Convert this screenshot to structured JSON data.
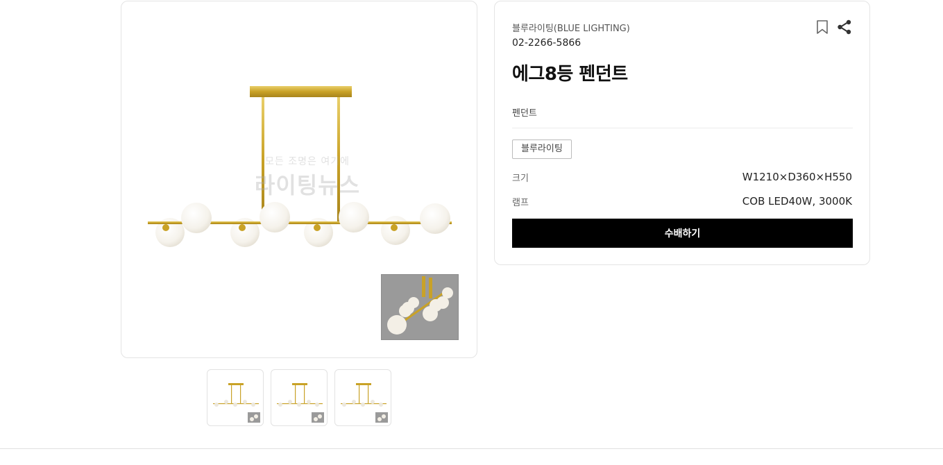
{
  "product": {
    "brand": "블루라이팅(BLUE LIGHTING)",
    "phone": "02-2266-5866",
    "title": "에그8등 펜던트",
    "category": "펜던트",
    "tag": "블루라이팅",
    "specs": [
      {
        "label": "크기",
        "value": "W1210×D360×H550"
      },
      {
        "label": "램프",
        "value": "COB LED40W, 3000K"
      }
    ],
    "import_button": "수배하기"
  },
  "gallery": {
    "watermark_line1": "모든 조명은 여기에",
    "watermark_line2": "라이팅뉴스",
    "thumbnail_count": 3
  },
  "icons": {
    "bookmark": "bookmark-icon",
    "share": "share-icon"
  },
  "colors": {
    "gold": "#c9a227",
    "globe": "#f4f1ea",
    "button_bg": "#000000"
  }
}
